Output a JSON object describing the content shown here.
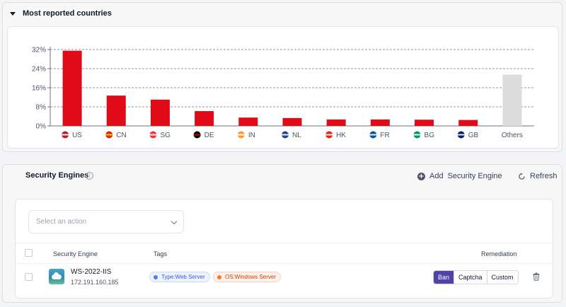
{
  "countries_panel": {
    "title": "Most reported countries"
  },
  "chart_data": {
    "type": "bar",
    "categories": [
      "US",
      "CN",
      "SG",
      "DE",
      "IN",
      "NL",
      "HK",
      "FR",
      "BG",
      "GB",
      "Others"
    ],
    "values": [
      31.5,
      12.7,
      11.0,
      6.2,
      3.5,
      3.3,
      2.7,
      2.7,
      2.6,
      2.5,
      21.5
    ],
    "flags": [
      "us-flag-icon",
      "cn-flag-icon",
      "sg-flag-icon",
      "de-flag-icon",
      "in-flag-icon",
      "nl-flag-icon",
      "hk-flag-icon",
      "fr-flag-icon",
      "bg-flag-icon",
      "gb-flag-icon",
      ""
    ],
    "yticks": [
      0,
      8,
      16,
      24,
      32
    ],
    "ytick_labels": [
      "0%",
      "8%",
      "16%",
      "24%",
      "32%"
    ],
    "ylim": [
      0,
      32
    ],
    "title": "",
    "xlabel": "",
    "ylabel": "",
    "grid": true,
    "colors": {
      "bar": "#e00b16",
      "others": "#dcdcdc"
    }
  },
  "engines_panel": {
    "title": "Security Engines",
    "add_label": "Add",
    "add_label_2": "Security Engine",
    "refresh_label": "Refresh",
    "select_placeholder": "Select an action",
    "columns": {
      "engine": "Security Engine",
      "tags": "Tags",
      "remediation": "Remediation"
    },
    "rows": [
      {
        "name": "WS-2022-IIS",
        "ip": "172.191.160.185",
        "tags": [
          "Type:Web Server",
          "OS:Windows Server"
        ],
        "remediation": [
          "Ban",
          "Captcha",
          "Custom"
        ],
        "selected_remediation": "Ban"
      }
    ]
  }
}
